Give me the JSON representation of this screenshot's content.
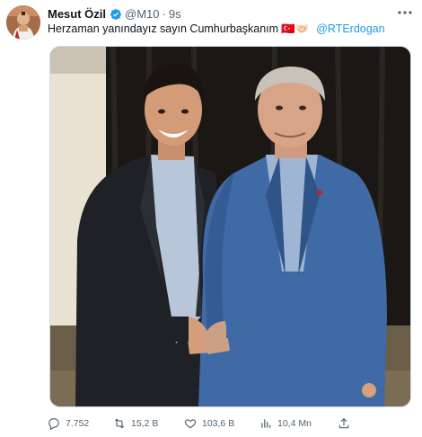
{
  "tweet": {
    "author_name": "Mesut Özil",
    "handle": "@M10",
    "separator": "·",
    "time": "9s",
    "text": "Herzaman yanındayız sayın Cumhurbaşkanım",
    "emojis": "🇹🇷🤝🏻",
    "mention": "@RTErdogan",
    "more_icon": "more-horizontal-icon",
    "image_description_icon": "photo"
  },
  "actions": {
    "replies": "7.752",
    "retweets": "15,2 B",
    "likes": "103,6 B",
    "views": "10,4 Mn"
  },
  "colors": {
    "text": "#0f1419",
    "secondary": "#536471",
    "link": "#1d9bf0",
    "verified": "#1d9bf0"
  }
}
